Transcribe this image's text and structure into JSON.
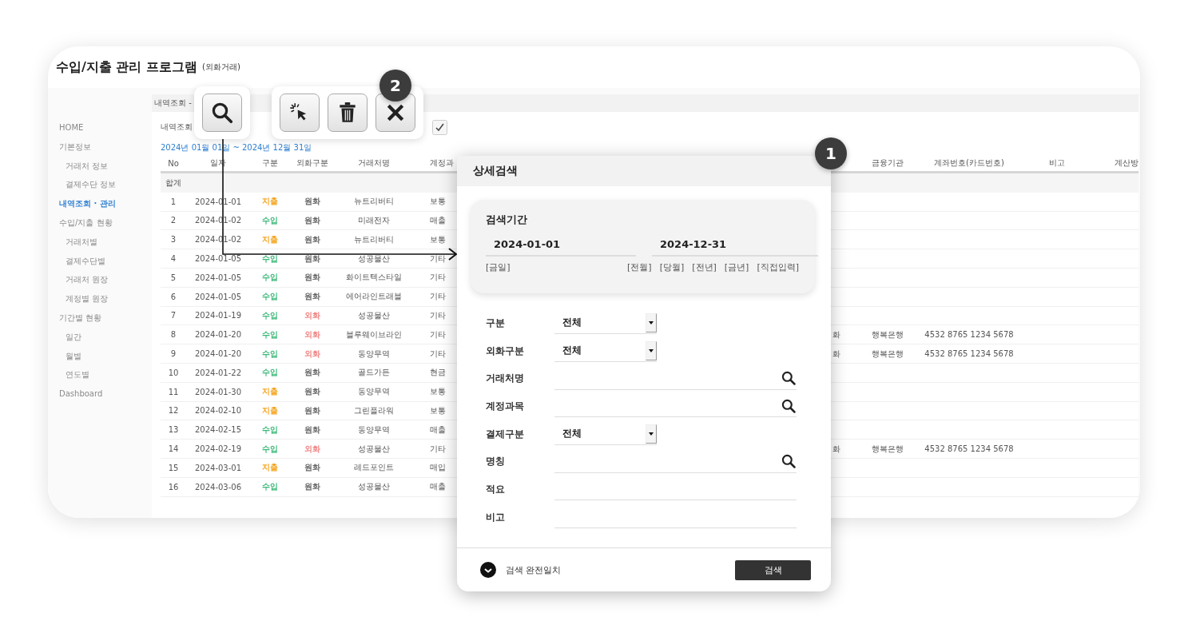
{
  "window": {
    "title": "수입/지출 관리 프로그램",
    "subtitle": "(외화거래)"
  },
  "sidebar": {
    "items": [
      {
        "label": "HOME",
        "selected": false
      },
      {
        "label": "기본정보",
        "selected": false,
        "children": [
          {
            "label": "거래처 정보",
            "selected": false
          },
          {
            "label": "결제수단 정보",
            "selected": false
          }
        ]
      },
      {
        "label": "내역조회 · 관리",
        "selected": true
      },
      {
        "label": "수입/지출 현황",
        "selected": false,
        "children": [
          {
            "label": "거래처별",
            "selected": false
          },
          {
            "label": "결제수단별",
            "selected": false
          },
          {
            "label": "거래처 원장",
            "selected": false
          },
          {
            "label": "계정별 원장",
            "selected": false
          }
        ]
      },
      {
        "label": "기간별 현황",
        "selected": false,
        "children": [
          {
            "label": "일간",
            "selected": false
          },
          {
            "label": "월별",
            "selected": false
          },
          {
            "label": "연도별",
            "selected": false
          }
        ]
      },
      {
        "label": "Dashboard",
        "selected": false
      }
    ]
  },
  "breadcrumb": "내역조회 -",
  "panel": {
    "title": "내역조회",
    "checked": true,
    "period": "2024년 01월 01일 ~ 2024년 12월 31일"
  },
  "table": {
    "columns": [
      "No",
      "일자",
      "구분",
      "외화구분",
      "거래처명",
      "계정과",
      "금융기관",
      "계좌번호(카드번호)",
      "비고",
      "계산방"
    ],
    "total_label": "합계",
    "rows": [
      {
        "no": "1",
        "date": "2024-01-01",
        "type": {
          "text": "지출",
          "color": "#f5a623"
        },
        "currency": {
          "text": "원화",
          "color": "#666666"
        },
        "vendor": "뉴트리버티",
        "account": "보통"
      },
      {
        "no": "2",
        "date": "2024-01-02",
        "type": {
          "text": "수입",
          "color": "#3cb878"
        },
        "currency": {
          "text": "원화",
          "color": "#666666"
        },
        "vendor": "미래전자",
        "account": "매출"
      },
      {
        "no": "3",
        "date": "2024-01-02",
        "type": {
          "text": "지출",
          "color": "#f5a623"
        },
        "currency": {
          "text": "원화",
          "color": "#666666"
        },
        "vendor": "뉴트리버티",
        "account": "보통"
      },
      {
        "no": "4",
        "date": "2024-01-05",
        "type": {
          "text": "수입",
          "color": "#3cb878"
        },
        "currency": {
          "text": "원화",
          "color": "#666666"
        },
        "vendor": "성공물산",
        "account": "기타"
      },
      {
        "no": "5",
        "date": "2024-01-05",
        "type": {
          "text": "수입",
          "color": "#3cb878"
        },
        "currency": {
          "text": "원화",
          "color": "#666666"
        },
        "vendor": "화이트텍스타일",
        "account": "기타"
      },
      {
        "no": "6",
        "date": "2024-01-05",
        "type": {
          "text": "수입",
          "color": "#3cb878"
        },
        "currency": {
          "text": "원화",
          "color": "#666666"
        },
        "vendor": "에어라인트래블",
        "account": "기타"
      },
      {
        "no": "7",
        "date": "2024-01-19",
        "type": {
          "text": "수입",
          "color": "#3cb878"
        },
        "currency": {
          "text": "외화",
          "color": "#f08080"
        },
        "vendor": "성공물산",
        "account": "기타"
      },
      {
        "no": "8",
        "date": "2024-01-20",
        "type": {
          "text": "수입",
          "color": "#3cb878"
        },
        "currency": {
          "text": "외화",
          "color": "#f08080"
        },
        "vendor": "블루웨이브라인",
        "account": "기타",
        "column_7": "화",
        "bank": "행복은행",
        "account_no": "4532 8765 1234 5678"
      },
      {
        "no": "9",
        "date": "2024-01-20",
        "type": {
          "text": "수입",
          "color": "#3cb878"
        },
        "currency": {
          "text": "외화",
          "color": "#f08080"
        },
        "vendor": "동양무역",
        "account": "기타",
        "column_7": "화",
        "bank": "행복은행",
        "account_no": "4532 8765 1234 5678"
      },
      {
        "no": "10",
        "date": "2024-01-22",
        "type": {
          "text": "수입",
          "color": "#3cb878"
        },
        "currency": {
          "text": "원화",
          "color": "#666666"
        },
        "vendor": "골드가든",
        "account": "현금"
      },
      {
        "no": "11",
        "date": "2024-01-30",
        "type": {
          "text": "지출",
          "color": "#f5a623"
        },
        "currency": {
          "text": "원화",
          "color": "#666666"
        },
        "vendor": "동양무역",
        "account": "보통"
      },
      {
        "no": "12",
        "date": "2024-02-10",
        "type": {
          "text": "지출",
          "color": "#f5a623"
        },
        "currency": {
          "text": "원화",
          "color": "#666666"
        },
        "vendor": "그린플라워",
        "account": "보통"
      },
      {
        "no": "13",
        "date": "2024-02-15",
        "type": {
          "text": "수입",
          "color": "#3cb878"
        },
        "currency": {
          "text": "원화",
          "color": "#666666"
        },
        "vendor": "동양무역",
        "account": "매출"
      },
      {
        "no": "14",
        "date": "2024-02-19",
        "type": {
          "text": "수입",
          "color": "#3cb878"
        },
        "currency": {
          "text": "외화",
          "color": "#f08080"
        },
        "vendor": "성공물산",
        "account": "기타",
        "column_7": "화",
        "bank": "행복은행",
        "account_no": "4532 8765 1234 5678"
      },
      {
        "no": "15",
        "date": "2024-03-01",
        "type": {
          "text": "지출",
          "color": "#f5a623"
        },
        "currency": {
          "text": "원화",
          "color": "#666666"
        },
        "vendor": "레드포인트",
        "account": "매입"
      },
      {
        "no": "16",
        "date": "2024-03-06",
        "type": {
          "text": "수입",
          "color": "#3cb878"
        },
        "currency": {
          "text": "원화",
          "color": "#666666"
        },
        "vendor": "성공물산",
        "account": "매출"
      }
    ]
  },
  "toolbar": {
    "badge": "2",
    "groups": [
      [
        {
          "kind": "search"
        }
      ],
      [
        {
          "kind": "select"
        },
        {
          "kind": "delete"
        },
        {
          "kind": "close"
        }
      ]
    ]
  },
  "search_dialog": {
    "title": "상세검색",
    "badge": "1",
    "period": {
      "label": "검색기간",
      "from": "2024-01-01",
      "to": "2024-12-31",
      "quick": [
        "[금일]",
        "[전월]",
        "[당월]",
        "[전년]",
        "[금년]",
        "[직접입력]"
      ]
    },
    "fields": [
      {
        "label": "구분",
        "kind": "select",
        "value": "전체"
      },
      {
        "label": "외화구분",
        "kind": "select",
        "value": "전체"
      },
      {
        "label": "거래처명",
        "kind": "lookup"
      },
      {
        "label": "계정과목",
        "kind": "lookup"
      },
      {
        "label": "결제구분",
        "kind": "select",
        "value": "전체"
      },
      {
        "label": "명칭",
        "kind": "lookup"
      },
      {
        "label": "적요",
        "kind": "text"
      },
      {
        "label": "비고",
        "kind": "text"
      }
    ],
    "exact_match": {
      "label": "검색 완전일치",
      "checked": true
    },
    "search_button": "검색"
  }
}
